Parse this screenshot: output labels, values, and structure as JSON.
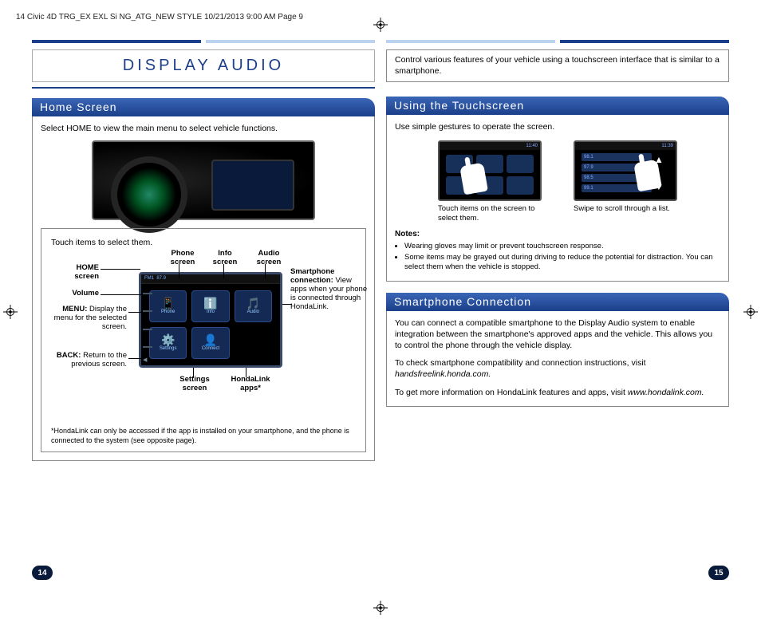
{
  "header_line": "14 Civic 4D TRG_EX EXL Si NG_ATG_NEW STYLE  10/21/2013  9:00 AM  Page 9",
  "title": "DISPLAY AUDIO",
  "intro": "Control various features of your vehicle using a touchscreen interface that is similar to a smartphone.",
  "home": {
    "heading": "Home Screen",
    "lead": "Select HOME to view the main menu to select vehicle functions.",
    "hint": "Touch items to select them.",
    "labels": {
      "home": "HOME screen",
      "volume": "Volume",
      "menu_b": "MENU:",
      "menu_t": "Display the menu for the selected screen.",
      "back_b": "BACK:",
      "back_t": "Return to the previous screen.",
      "phone": "Phone screen",
      "info": "Info screen",
      "audio": "Audio screen",
      "settings": "Settings screen",
      "hondalink": "HondaLink apps*",
      "smart_b": "Smartphone connection:",
      "smart_t": "View apps when your phone is connected through HondaLink."
    },
    "icons": {
      "phone": "Phone",
      "info": "Info",
      "audio": "Audio",
      "settings": "Settings",
      "connect": "Connect"
    },
    "footnote": "*HondaLink can only be accessed if the app is installed on your smartphone, and the phone is connected to the system (see opposite page)."
  },
  "touch": {
    "heading": "Using the Touchscreen",
    "lead": "Use simple gestures to operate the screen.",
    "cap1": "Touch items on the screen to select them.",
    "cap2": "Swipe to scroll through a list.",
    "time1": "11:40",
    "time2": "11:39",
    "notes_head": "Notes:",
    "notes": [
      "Wearing gloves may limit or prevent touchscreen response.",
      "Some items may be grayed out during driving to reduce the potential for distraction. You can select them when the vehicle is stopped."
    ]
  },
  "smart": {
    "heading": "Smartphone Connection",
    "p1": "You can connect a compatible smartphone to the Display Audio system to enable integration between the smartphone's approved apps and the vehicle. This allows you to control the phone through the vehicle display.",
    "p2a": "To check smartphone compatibility and connection instructions, visit ",
    "p2b": "handsfreelink.honda.com.",
    "p3a": "To get more information on HondaLink features and apps, visit ",
    "p3b": "www.hondalink.com."
  },
  "page_left": "14",
  "page_right": "15"
}
